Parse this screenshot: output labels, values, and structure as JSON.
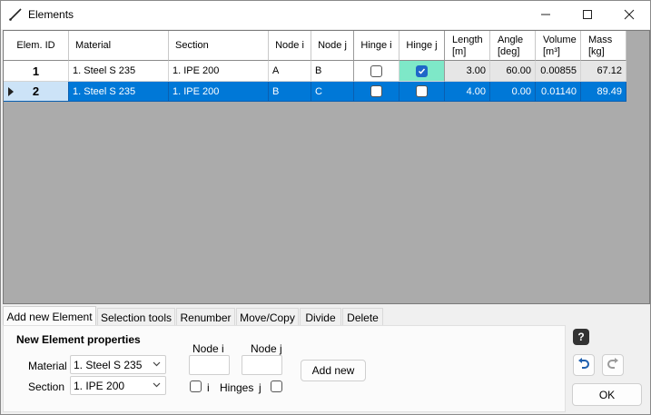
{
  "window": {
    "title": "Elements"
  },
  "grid": {
    "headers": {
      "elem_id": "Elem. ID",
      "material": "Material",
      "section": "Section",
      "node_i": "Node i",
      "node_j": "Node j",
      "hinge_i": "Hinge i",
      "hinge_j": "Hinge j",
      "length": [
        "Length",
        "[m]"
      ],
      "angle": [
        "Angle",
        "[deg]"
      ],
      "volume": [
        "Volume",
        "[m³]"
      ],
      "mass": [
        "Mass",
        "[kg]"
      ]
    },
    "rows": [
      {
        "id": "1",
        "material": "1. Steel S 235",
        "section": "1. IPE 200",
        "node_i": "A",
        "node_j": "B",
        "hinge_i": false,
        "hinge_j": true,
        "length": "3.00",
        "angle": "60.00",
        "volume": "0.00855",
        "mass": "67.12",
        "selected": false
      },
      {
        "id": "2",
        "material": "1. Steel S 235",
        "section": "1. IPE 200",
        "node_i": "B",
        "node_j": "C",
        "hinge_i": false,
        "hinge_j": false,
        "length": "4.00",
        "angle": "0.00",
        "volume": "0.01140",
        "mass": "89.49",
        "selected": true
      }
    ]
  },
  "tabs": [
    {
      "label": "Add new Element",
      "active": true
    },
    {
      "label": "Selection tools",
      "active": false
    },
    {
      "label": "Renumber",
      "active": false
    },
    {
      "label": "Move/Copy",
      "active": false
    },
    {
      "label": "Divide",
      "active": false
    },
    {
      "label": "Delete",
      "active": false
    }
  ],
  "panel": {
    "heading": "New Element properties",
    "material_label": "Material",
    "material_value": "1. Steel S 235",
    "section_label": "Section",
    "section_value": "1. IPE 200",
    "node_i_label": "Node i",
    "node_j_label": "Node j",
    "hinge_i_label": "i",
    "hinges_label": "Hinges",
    "hinge_j_label": "j",
    "add_button": "Add new"
  },
  "side": {
    "help": "?",
    "ok": "OK"
  },
  "colors": {
    "selected_row": "#0078d7",
    "hinge_checked_bg": "#7ee8c8",
    "checkbox_on": "#1e66c8"
  }
}
